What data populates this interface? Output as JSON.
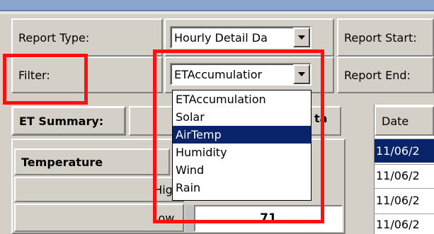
{
  "report_type": {
    "label": "Report Type:",
    "value": "Hourly Detail Da"
  },
  "filter": {
    "label": "Filter:",
    "value": "ETAccumulatior",
    "options": [
      "ETAccumulation",
      "Solar",
      "AirTemp",
      "Humidity",
      "Wind",
      "Rain"
    ],
    "highlighted": "AirTemp"
  },
  "report_start": {
    "label": "Report Start:"
  },
  "report_end": {
    "label": "Report End:"
  },
  "et_summary": {
    "label": "ET Summary:",
    "partial_left": "[",
    "partial_right": "ta"
  },
  "temperature": {
    "heading": "Temperature",
    "high_label": "High",
    "low_label": "Low.",
    "low_value": "71"
  },
  "date_column": {
    "header": "Date",
    "rows": [
      "11/06/2",
      "11/06/2",
      "11/06/2",
      "11/06/2"
    ]
  },
  "colors": {
    "highlight": "#0a246a",
    "annotation": "#ff1010"
  }
}
